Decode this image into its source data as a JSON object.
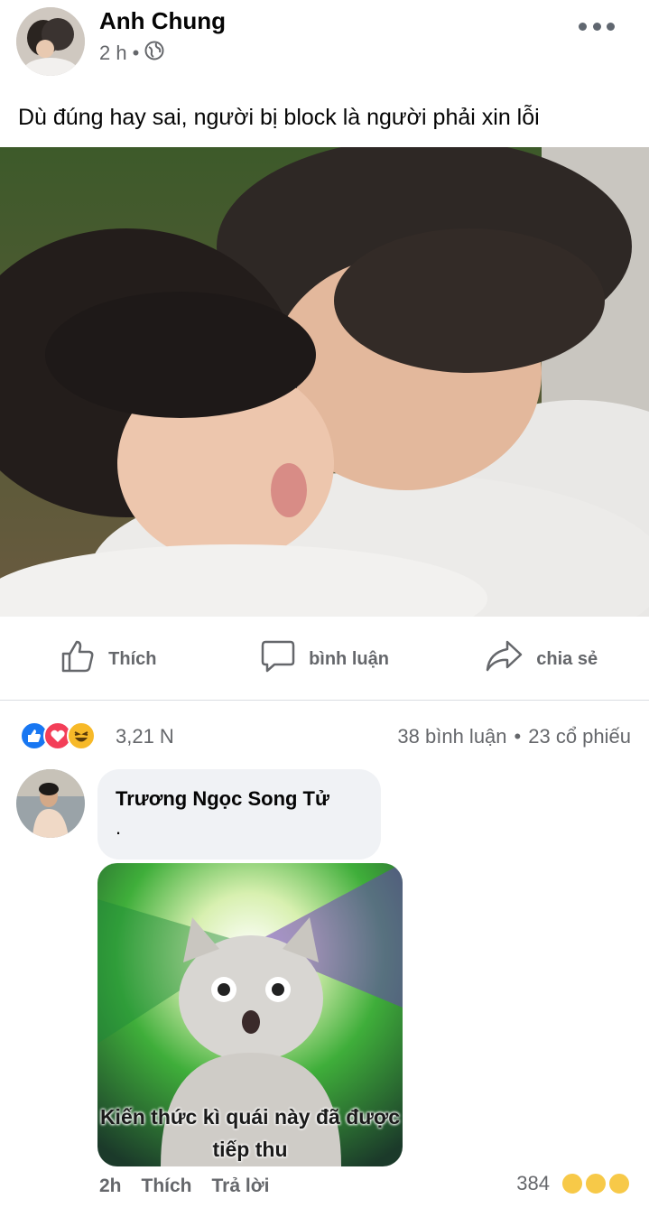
{
  "post": {
    "author": "Anh Chung",
    "time": "2 h",
    "separator": "•",
    "privacy_icon": "globe-icon",
    "text": "Dù đúng hay sai, người bị block là người phải xin lỗi"
  },
  "actions": {
    "like": "Thích",
    "comment": "bình luận",
    "share": "chia sẻ"
  },
  "stats": {
    "reaction_count": "3,21 N",
    "comments": "38 bình luận",
    "dot": "•",
    "shares": "23 cổ phiếu"
  },
  "comment": {
    "name": "Trương Ngọc Song Tử",
    "text": ".",
    "sticker_line1": "Kiến thức kì quái này đã được",
    "sticker_line2": "tiếp thu",
    "time": "2h",
    "like": "Thích",
    "reply": "Trả lời",
    "reaction_count": "384"
  },
  "colors": {
    "like_blue": "#1877f2",
    "love_red": "#f33e58",
    "haha_yellow": "#f7b928",
    "meta_gray": "#65676b"
  }
}
